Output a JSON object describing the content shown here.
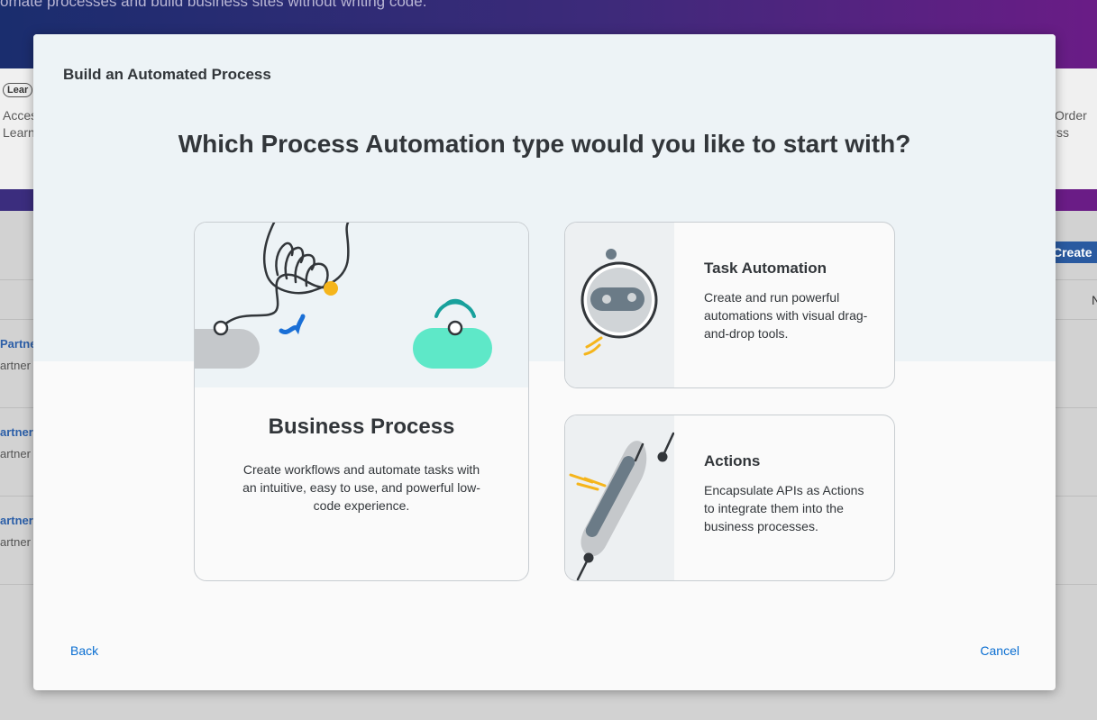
{
  "background": {
    "hero_text": "omate processes and build business sites without writing code.",
    "pill_label": "Lear",
    "left_text_1": "Acces",
    "left_text_2": "Learn",
    "right_text_1": "Order",
    "right_text_2": "ss",
    "create_label": "Create",
    "right_edge_text": "N",
    "rows": [
      {
        "link": "Partne",
        "sub": "artner"
      },
      {
        "link": "artner",
        "sub": "artner"
      },
      {
        "link": "artner",
        "sub": "artner"
      }
    ]
  },
  "dialog": {
    "title": "Build an Automated Process",
    "question": "Which Process Automation type would you like to start with?",
    "cards": {
      "business_process": {
        "heading": "Business Process",
        "description": "Create workflows and automate tasks with an intuitive, easy to use, and powerful low-code experience."
      },
      "task_automation": {
        "heading": "Task Automation",
        "description": "Create and run powerful automations with visual drag-and-drop tools."
      },
      "actions": {
        "heading": "Actions",
        "description": "Encapsulate APIs as Actions to integrate them into the business processes."
      }
    },
    "footer": {
      "back_label": "Back",
      "cancel_label": "Cancel"
    }
  },
  "colors": {
    "accent_link": "#0a6ed1",
    "mint": "#5ee8c8",
    "teal": "#18a19c",
    "yellow": "#f5b51c",
    "blue_squiggle": "#1a6fd6",
    "dark_text": "#32363a"
  }
}
